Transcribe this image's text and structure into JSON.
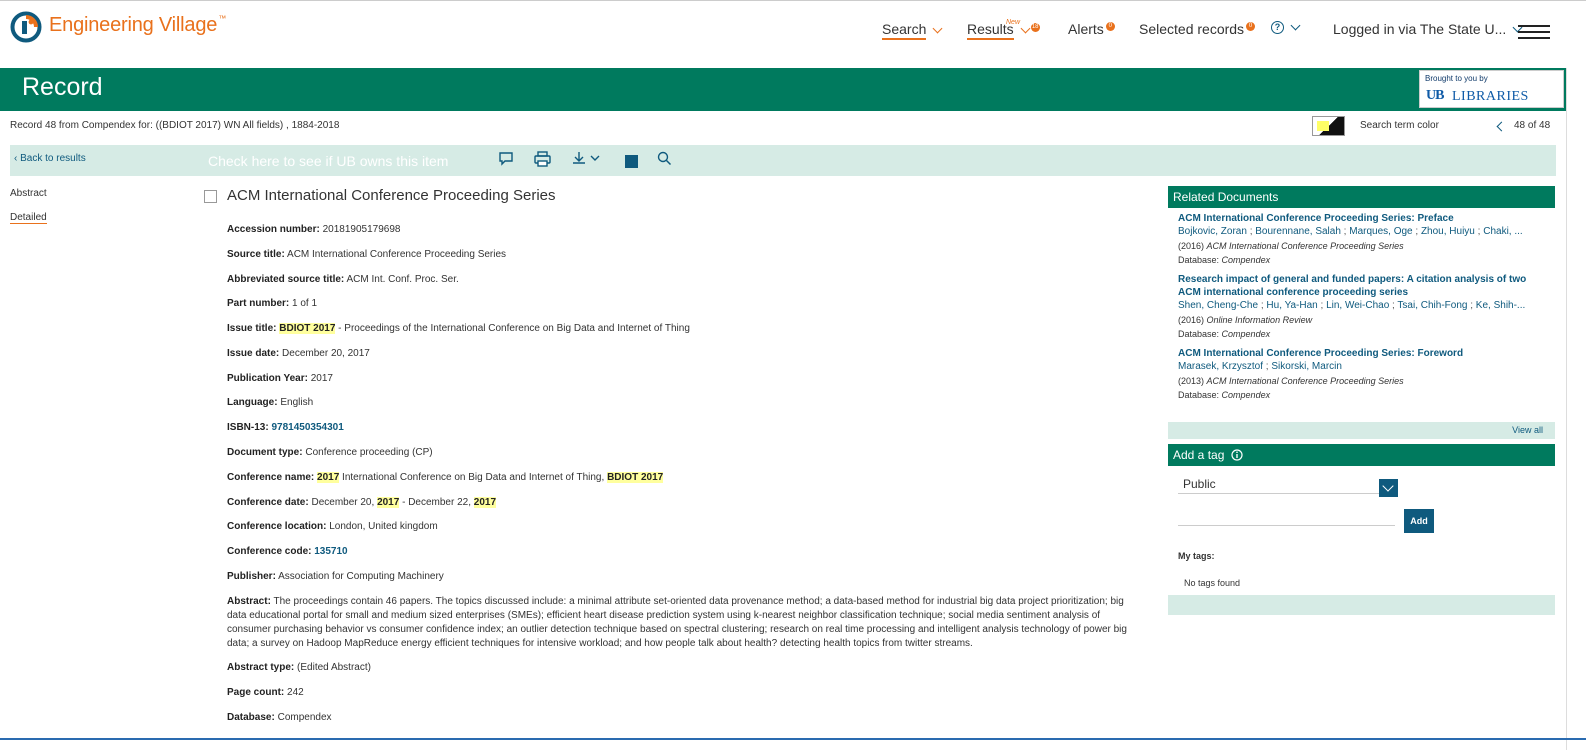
{
  "brand": {
    "name": "Engineering Village",
    "tm": "™"
  },
  "nav": {
    "search": "Search",
    "results": "Results",
    "results_new": "New",
    "results_count": "18",
    "alerts": "Alerts",
    "alerts_count": "0",
    "selected": "Selected records",
    "selected_count": "0",
    "help": "?",
    "login": "Logged in via The State U..."
  },
  "record_header": {
    "title": "Record",
    "brought_by": "Brought to you by",
    "lib_logo_ub": "UB",
    "lib_logo_text": "LIBRARIES"
  },
  "subline": "Record 48 from Compendex for: ((BDIOT 2017) WN All fields) , 1884-2018",
  "search_term_color_label": "Search term color",
  "pager": "48 of 48",
  "toolbar": {
    "back": "Back to results",
    "check_ub": "Check here to see if UB owns this item"
  },
  "leftnav": {
    "abstract": "Abstract",
    "detailed": "Detailed"
  },
  "record": {
    "title": "ACM International Conference Proceeding Series",
    "accession_label": "Accession number:",
    "accession": "20181905179698",
    "source_title_label": "Source title:",
    "source_title": "ACM International Conference Proceeding Series",
    "abbr_label": "Abbreviated source title:",
    "abbr": "ACM Int. Conf. Proc. Ser.",
    "part_label": "Part number:",
    "part": "1 of 1",
    "issue_title_label": "Issue title:",
    "issue_title_hl": "BDIOT 2017",
    "issue_title_rest": " - Proceedings of the International Conference on Big Data and Internet of Thing",
    "issue_date_label": "Issue date:",
    "issue_date": "December 20, 2017",
    "pubyear_label": "Publication Year:",
    "pubyear": "2017",
    "language_label": "Language:",
    "language": "English",
    "isbn_label": "ISBN-13:",
    "isbn": "9781450354301",
    "doctype_label": "Document type:",
    "doctype": "Conference proceeding (CP)",
    "confname_label": "Conference name:",
    "confname_hl1": "2017",
    "confname_mid": " International Conference on Big Data and Internet of Thing, ",
    "confname_hl2": "BDIOT 2017",
    "confdate_label": "Conference date:",
    "confdate_a": "December 20, ",
    "confdate_hl1": "2017",
    "confdate_b": " - December 22, ",
    "confdate_hl2": "2017",
    "confloc_label": "Conference location:",
    "confloc": "London, United kingdom",
    "confcode_label": "Conference code:",
    "confcode": "135710",
    "publisher_label": "Publisher:",
    "publisher": "Association for Computing Machinery",
    "abstract_label": "Abstract:",
    "abstract": "The proceedings contain 46 papers. The topics discussed include: a minimal attribute set-oriented data provenance method; a data-based method for industrial big data project prioritization; big data educational portal for small and medium sized enterprises (SMEs); efficient heart disease prediction system using k-nearest neighbor classification technique; social media sentiment analysis of consumer purchasing behavior vs consumer confidence index; an outlier detection technique based on spectral clustering; research on real time processing and intelligent analysis technology of power big data; a survey on Hadoop MapReduce energy efficient techniques for intensive workload; and how people talk about health? detecting health topics from twitter streams.",
    "abstract_type_label": "Abstract type:",
    "abstract_type": "(Edited Abstract)",
    "pagecount_label": "Page count:",
    "pagecount": "242",
    "database_label": "Database:",
    "database": "Compendex"
  },
  "related": {
    "heading": "Related Documents",
    "items": [
      {
        "title": "ACM International Conference Proceeding Series: Preface",
        "authors": [
          "Bojkovic, Zoran",
          "Bourennane, Salah",
          "Marques, Oge",
          "Zhou, Huiyu",
          "Chaki, ..."
        ],
        "year": "(2016)",
        "source": "ACM International Conference Proceeding Series",
        "db_label": "Database:",
        "db": "Compendex"
      },
      {
        "title": "Research impact of general and funded papers: A citation analysis of two ACM international conference proceeding series",
        "authors": [
          "Shen, Cheng-Che",
          "Hu, Ya-Han",
          "Lin, Wei-Chao",
          "Tsai, Chih-Fong",
          "Ke, Shih-..."
        ],
        "year": "(2016)",
        "source": "Online Information Review",
        "db_label": "Database:",
        "db": "Compendex"
      },
      {
        "title": "ACM International Conference Proceeding Series: Foreword",
        "authors": [
          "Marasek, Krzysztof",
          "Sikorski, Marcin"
        ],
        "year": "(2013)",
        "source": "ACM International Conference Proceeding Series",
        "db_label": "Database:",
        "db": "Compendex"
      }
    ],
    "view_all": "View all"
  },
  "tag": {
    "heading": "Add a tag",
    "select_value": "Public",
    "add": "Add",
    "my_tags": "My tags:",
    "no_tags": "No tags found"
  },
  "colors": {
    "brand_orange": "#e9711c",
    "header_green": "#007a5e",
    "link_blue": "#0f5a7e",
    "toolbar_bg": "#d6ebe5",
    "highlight": "#ffff9e"
  }
}
